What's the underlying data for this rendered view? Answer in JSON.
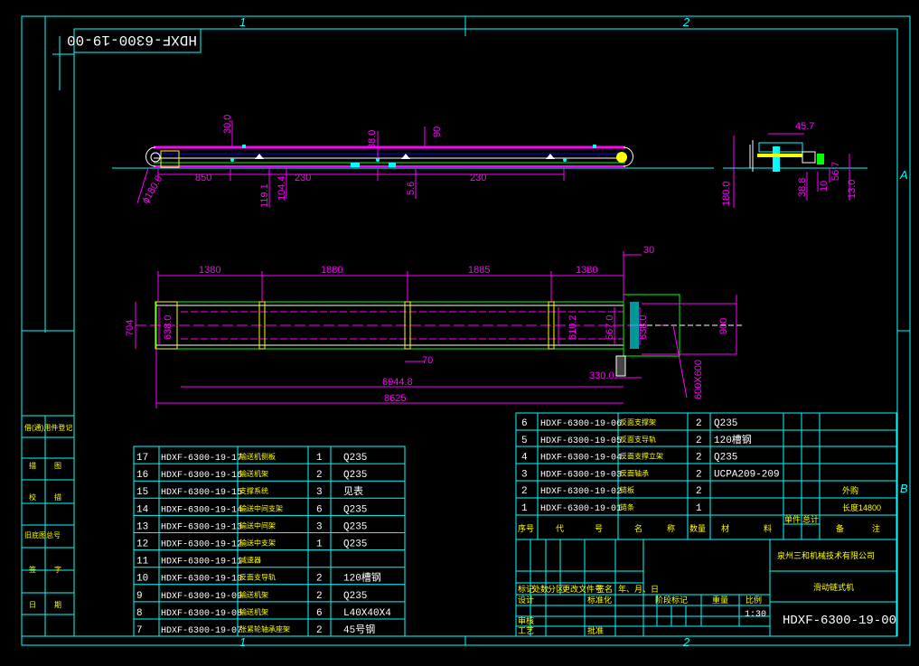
{
  "drawing": {
    "title_block_number": "HDXF-6300-19-00",
    "mirrored_number": "HDXF-6300-19-00",
    "scale": "1:30",
    "zone_top": [
      "1",
      "2"
    ],
    "zone_bottom": [
      "1",
      "2"
    ],
    "zone_right": [
      "A",
      "B"
    ]
  },
  "dims_side": [
    "30.0",
    "38.0",
    "90",
    "850",
    "230",
    "230",
    "119.1",
    "104.4",
    "5.6",
    "ϕ180.0",
    "180.0"
  ],
  "dims_section": [
    "45.7",
    "38.8",
    "10",
    "56.7",
    "13.0"
  ],
  "dims_plan": [
    "1380",
    "1880",
    "1885",
    "1380",
    "30",
    "704",
    "638.0",
    "610.2",
    "567.0",
    "638.0",
    "900",
    "70",
    "330.0",
    "6944.8",
    "8625",
    "600X600"
  ],
  "parts_upper": [
    {
      "no": "6",
      "code": "HDXF-6300-19-06",
      "name": "反面支撑架",
      "qty": "2",
      "material": "Q235",
      "remark": ""
    },
    {
      "no": "5",
      "code": "HDXF-6300-19-05",
      "name": "反面支导轨",
      "qty": "2",
      "material": "120槽钢",
      "remark": ""
    },
    {
      "no": "4",
      "code": "HDXF-6300-19-04",
      "name": "反面支撑立架",
      "qty": "2",
      "material": "Q235",
      "remark": ""
    },
    {
      "no": "3",
      "code": "HDXF-6300-19-03",
      "name": "反面轴承",
      "qty": "2",
      "material": "UCPA209-209",
      "remark": ""
    },
    {
      "no": "2",
      "code": "HDXF-6300-19-02",
      "name": "链板",
      "qty": "2",
      "material": "",
      "remark": "外购"
    },
    {
      "no": "1",
      "code": "HDXF-6300-19-01",
      "name": "链条",
      "qty": "1",
      "material": "",
      "remark": "长度14800"
    }
  ],
  "parts_upper_header": [
    "序号",
    "代",
    "号",
    "名",
    "称",
    "数量",
    "材",
    "料",
    "单件",
    "总计",
    "备",
    "注"
  ],
  "parts_lower": [
    {
      "no": "17",
      "code": "HDXF-6300-19-17",
      "name": "输送机侧板",
      "qty": "1",
      "material": "Q235"
    },
    {
      "no": "16",
      "code": "HDXF-6300-19-16",
      "name": "输送机架",
      "qty": "2",
      "material": "Q235"
    },
    {
      "no": "15",
      "code": "HDXF-6300-19-15",
      "name": "支撑系统",
      "qty": "3",
      "material": "见表"
    },
    {
      "no": "14",
      "code": "HDXF-6300-19-14",
      "name": "输送中间支架",
      "qty": "6",
      "material": "Q235"
    },
    {
      "no": "13",
      "code": "HDXF-6300-19-13",
      "name": "输送中间架",
      "qty": "3",
      "material": "Q235"
    },
    {
      "no": "12",
      "code": "HDXF-6300-19-12",
      "name": "输送中支架",
      "qty": "1",
      "material": "Q235"
    },
    {
      "no": "11",
      "code": "HDXF-6300-19-11",
      "name": "减速器",
      "qty": "",
      "material": ""
    },
    {
      "no": "10",
      "code": "HDXF-6300-19-10",
      "name": "反面支导轨",
      "qty": "2",
      "material": "120槽钢"
    },
    {
      "no": "9",
      "code": "HDXF-6300-19-09",
      "name": "输送机架",
      "qty": "2",
      "material": "Q235"
    },
    {
      "no": "8",
      "code": "HDXF-6300-19-08",
      "name": "输送机架",
      "qty": "6",
      "material": "L40X40X4"
    },
    {
      "no": "7",
      "code": "HDXF-6300-19-07",
      "name": "张紧轮轴承座架",
      "qty": "2",
      "material": "45号钢"
    }
  ],
  "left_strip": [
    "借(通)用件登记",
    "描",
    "图",
    "校",
    "描",
    "旧底图总号",
    "签",
    "字",
    "日",
    "期"
  ],
  "title_block": {
    "company": "泉州三和机械技术有限公司",
    "product": "滑动链式机",
    "row_labels": [
      "标记",
      "处数",
      "分区",
      "更改文件号",
      "签名",
      "年、月、日"
    ],
    "design": "设计",
    "standard": "标准化",
    "check": "审核",
    "process": "工艺",
    "approve": "批准",
    "stage": "阶段标记",
    "weight": "重量",
    "ratio": "比例"
  },
  "colors": {
    "bg": "#000000",
    "frame": "#00ffff",
    "dim": "#ff00ff",
    "part": "#ffffff",
    "green": "#00ff00",
    "yellow": "#ffff00"
  }
}
